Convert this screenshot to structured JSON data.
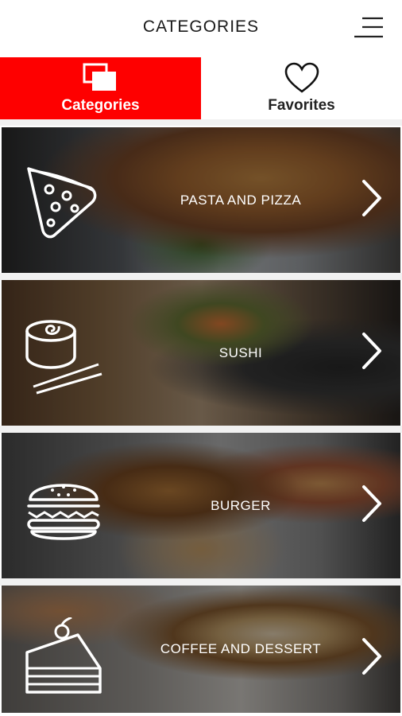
{
  "header": {
    "title": "CATEGORIES",
    "menu_icon": "hamburger-menu-icon"
  },
  "tabs": [
    {
      "label": "Categories",
      "icon": "categories-stack-icon",
      "active": true
    },
    {
      "label": "Favorites",
      "icon": "heart-icon",
      "active": false
    }
  ],
  "colors": {
    "accent": "#fe0000",
    "overlay_text": "#ffffff"
  },
  "categories": [
    {
      "label": "PASTA AND PIZZA",
      "icon": "pizza-slice-icon"
    },
    {
      "label": "SUSHI",
      "icon": "sushi-roll-icon"
    },
    {
      "label": "BURGER",
      "icon": "burger-icon"
    },
    {
      "label": "COFFEE AND DESSERT",
      "icon": "cake-slice-icon"
    }
  ]
}
